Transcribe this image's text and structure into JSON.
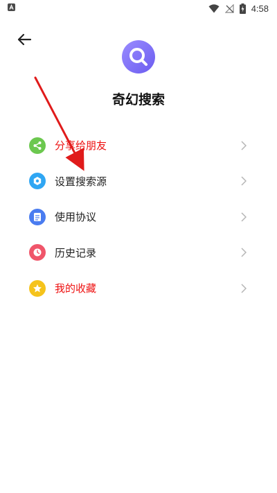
{
  "status_bar": {
    "time": "4:58",
    "icons": [
      "app-notification-icon",
      "wifi-icon",
      "no-signal-icon",
      "battery-charging-icon"
    ]
  },
  "header": {
    "back_icon": "back-arrow-icon"
  },
  "app": {
    "title": "奇幻搜索",
    "logo_icon": "magnifier-icon",
    "logo_color": "#7d6ff5"
  },
  "menu": {
    "items": [
      {
        "label": "分享给朋友",
        "icon": "share-icon",
        "icon_color": "#6cc84f",
        "label_color": "#ee1111"
      },
      {
        "label": "设置搜索源",
        "icon": "gear-icon",
        "icon_color": "#2fa6f3",
        "label_color": "#222222"
      },
      {
        "label": "使用协议",
        "icon": "document-icon",
        "icon_color": "#4a7cf0",
        "label_color": "#222222"
      },
      {
        "label": "历史记录",
        "icon": "clock-icon",
        "icon_color": "#f0556a",
        "label_color": "#222222"
      },
      {
        "label": "我的收藏",
        "icon": "star-icon",
        "icon_color": "#f5c31c",
        "label_color": "#ee1111"
      }
    ],
    "chevron_icon": "chevron-right-icon"
  },
  "annotation": {
    "color": "#e01b1b",
    "icon": "red-arrow-annotation"
  }
}
